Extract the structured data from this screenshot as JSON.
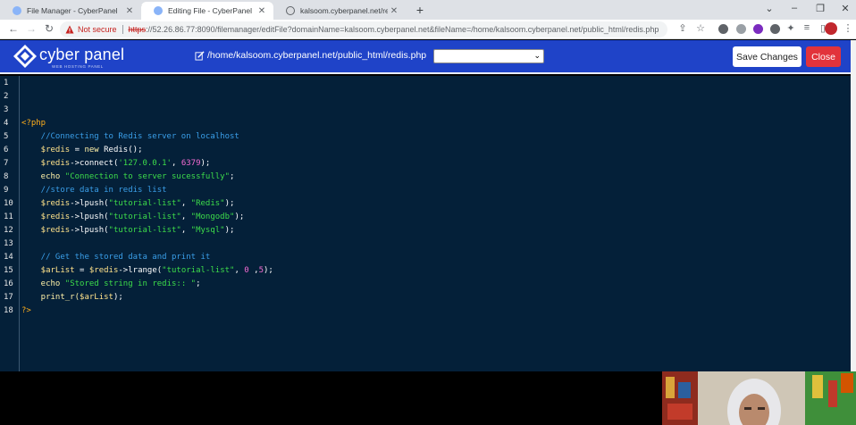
{
  "browser": {
    "tabs": [
      {
        "title": "File Manager - CyberPanel",
        "active": false,
        "favicon_color": "#5f6368"
      },
      {
        "title": "Editing File - CyberPanel",
        "active": true,
        "favicon_color": "#5f6368"
      },
      {
        "title": "kalsoom.cyberpanel.net/redis.php",
        "active": false,
        "favicon_color": "#5f6368"
      }
    ],
    "address": {
      "security_label": "Not secure",
      "url_protocol": "https",
      "url_rest": "://52.26.86.77:8090/filemanager/editFile?domainName=kalsoom.cyberpanel.net&fileName=/home/kalsoom.cyberpanel.net/public_html/redis.php"
    }
  },
  "cyberpanel": {
    "brand": "cyber panel",
    "tagline": "WEB HOSTING PANEL",
    "file_path": "/home/kalsoom.cyberpanel.net/public_html/redis.php",
    "select_value": "",
    "save_label": "Save Changes",
    "close_label": "Close",
    "colors": {
      "header": "#1f43c8",
      "close": "#e2333b",
      "editor_bg": "#042039"
    }
  },
  "editor": {
    "line_numbers": [
      "1",
      "2",
      "3",
      "4",
      "5",
      "6",
      "7",
      "8",
      "9",
      "10",
      "11",
      "12",
      "13",
      "14",
      "15",
      "16",
      "17",
      "18"
    ],
    "lines": [
      [],
      [],
      [],
      [
        {
          "t": "<?php",
          "c": "k"
        }
      ],
      [
        {
          "t": "    //Connecting to Redis server on localhost",
          "c": "c"
        }
      ],
      [
        {
          "t": "    $redis",
          "c": "v"
        },
        {
          "t": " = ",
          "c": "w"
        },
        {
          "t": "new",
          "c": "kw"
        },
        {
          "t": " Redis();",
          "c": "w"
        }
      ],
      [
        {
          "t": "    $redis",
          "c": "v"
        },
        {
          "t": "->connect(",
          "c": "w"
        },
        {
          "t": "'127.0.0.1'",
          "c": "s"
        },
        {
          "t": ", ",
          "c": "w"
        },
        {
          "t": "6379",
          "c": "n"
        },
        {
          "t": ");",
          "c": "w"
        }
      ],
      [
        {
          "t": "    echo ",
          "c": "kw"
        },
        {
          "t": "\"Connection to server sucessfully\"",
          "c": "s"
        },
        {
          "t": ";",
          "c": "w"
        }
      ],
      [
        {
          "t": "    //store data in redis list",
          "c": "c"
        }
      ],
      [
        {
          "t": "    $redis",
          "c": "v"
        },
        {
          "t": "->lpush(",
          "c": "w"
        },
        {
          "t": "\"tutorial-list\"",
          "c": "s"
        },
        {
          "t": ", ",
          "c": "w"
        },
        {
          "t": "\"Redis\"",
          "c": "s"
        },
        {
          "t": ");",
          "c": "w"
        }
      ],
      [
        {
          "t": "    $redis",
          "c": "v"
        },
        {
          "t": "->lpush(",
          "c": "w"
        },
        {
          "t": "\"tutorial-list\"",
          "c": "s"
        },
        {
          "t": ", ",
          "c": "w"
        },
        {
          "t": "\"Mongodb\"",
          "c": "s"
        },
        {
          "t": ");",
          "c": "w"
        }
      ],
      [
        {
          "t": "    $redis",
          "c": "v"
        },
        {
          "t": "->lpush(",
          "c": "w"
        },
        {
          "t": "\"tutorial-list\"",
          "c": "s"
        },
        {
          "t": ", ",
          "c": "w"
        },
        {
          "t": "\"Mysql\"",
          "c": "s"
        },
        {
          "t": ");",
          "c": "w"
        }
      ],
      [],
      [
        {
          "t": "    // Get the stored data and print it",
          "c": "c"
        }
      ],
      [
        {
          "t": "    $arList",
          "c": "v"
        },
        {
          "t": " = ",
          "c": "w"
        },
        {
          "t": "$redis",
          "c": "v"
        },
        {
          "t": "->lrange(",
          "c": "w"
        },
        {
          "t": "\"tutorial-list\"",
          "c": "s"
        },
        {
          "t": ", ",
          "c": "w"
        },
        {
          "t": "0",
          "c": "n"
        },
        {
          "t": " ,",
          "c": "w"
        },
        {
          "t": "5",
          "c": "n"
        },
        {
          "t": ");",
          "c": "w"
        }
      ],
      [
        {
          "t": "    echo ",
          "c": "kw"
        },
        {
          "t": "\"Stored string in redis:: \"",
          "c": "s"
        },
        {
          "t": ";",
          "c": "w"
        }
      ],
      [
        {
          "t": "    print_r(",
          "c": "kw"
        },
        {
          "t": "$arList",
          "c": "v"
        },
        {
          "t": ");",
          "c": "w"
        }
      ],
      [
        {
          "t": "?>",
          "c": "k"
        }
      ]
    ]
  }
}
